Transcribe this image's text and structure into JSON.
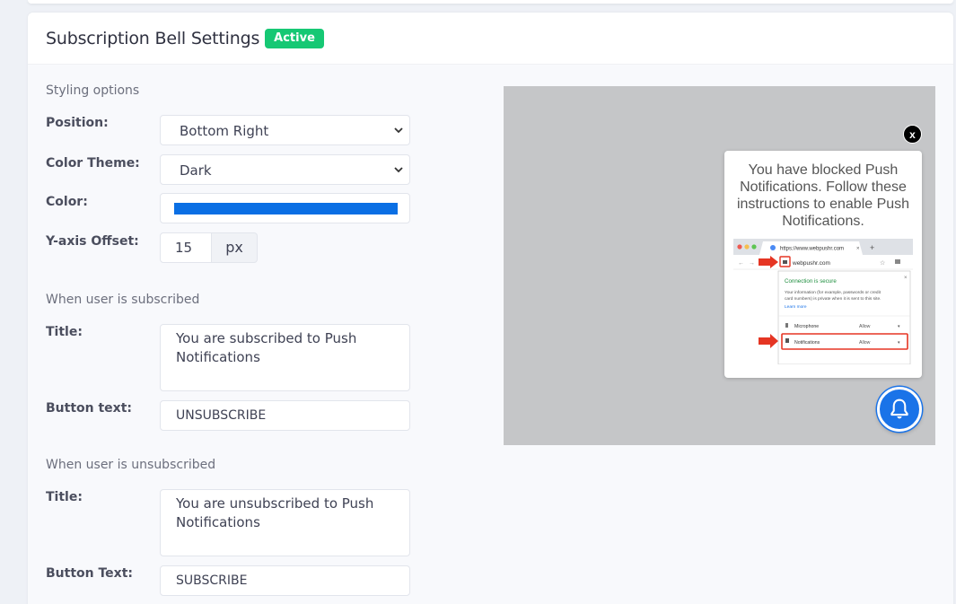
{
  "header": {
    "title": "Subscription Bell Settings",
    "status_badge": "Active"
  },
  "styling": {
    "section_label": "Styling options",
    "position": {
      "label": "Position:",
      "value": "Bottom Right"
    },
    "color_theme": {
      "label": "Color Theme:",
      "value": "Dark"
    },
    "color": {
      "label": "Color:",
      "value": "#0a6fe4"
    },
    "y_offset": {
      "label": "Y-axis Offset:",
      "value": "15",
      "unit": "px"
    }
  },
  "subscribed": {
    "section_label": "When user is subscribed",
    "title_label": "Title:",
    "title_value": "You are subscribed to Push Notifications",
    "button_label": "Button text:",
    "button_value": "UNSUBSCRIBE"
  },
  "unsubscribed": {
    "section_label": "When user is unsubscribed",
    "title_label": "Title:",
    "title_value": "You are unsubscribed to Push Notifications",
    "button_label": "Button Text:",
    "button_value": "SUBSCRIBE"
  },
  "preview": {
    "close_label": "x",
    "message": "You have blocked Push Notifications. Follow these instructions to enable Push Notifications.",
    "instructions": {
      "url": "https://www.webpushr.com",
      "address": "webpushr.com",
      "connection": "Connection is secure",
      "info": "Your information (for example, passwords or credit card numbers) is private when it is sent to this site.",
      "learn_more": "Learn more",
      "microphone": "Microphone",
      "notifications": "Notifications",
      "allow": "Allow"
    },
    "bell_icon": "bell-icon"
  }
}
